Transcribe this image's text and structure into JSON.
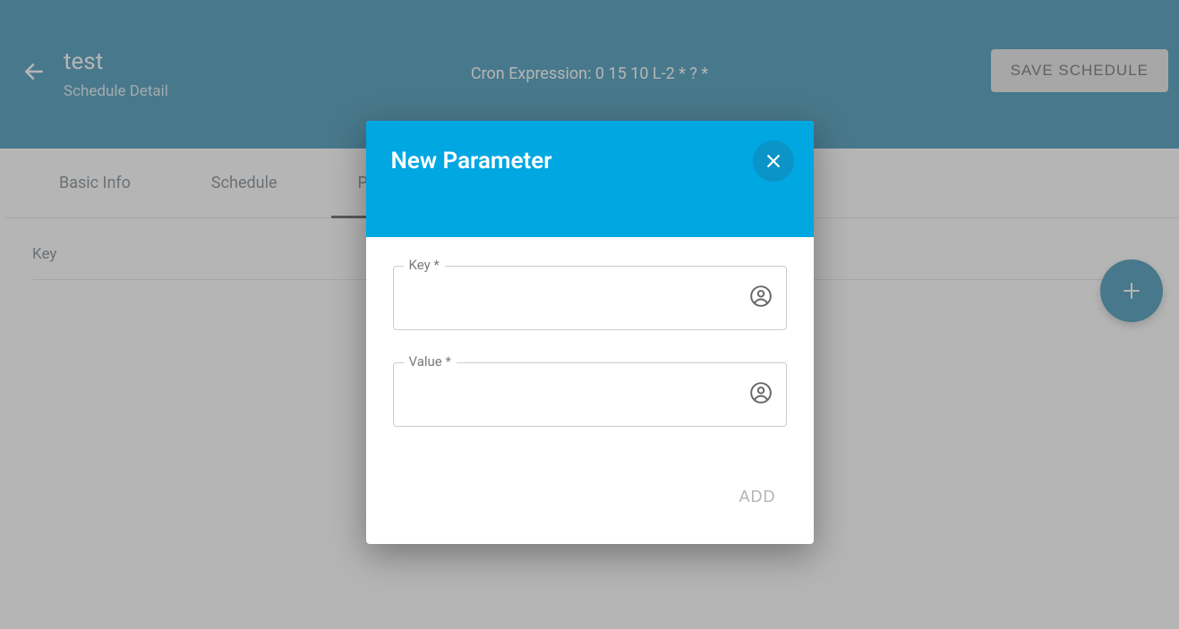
{
  "header": {
    "title": "test",
    "subtitle": "Schedule Detail",
    "cron_label": "Cron Expression: 0 15 10 L-2 * ? *",
    "save_label": "SAVE SCHEDULE"
  },
  "tabs": {
    "items": [
      {
        "label": "Basic Info"
      },
      {
        "label": "Schedule"
      },
      {
        "label": "Parameters"
      }
    ]
  },
  "table": {
    "columns": {
      "key_label": "Key"
    }
  },
  "dialog": {
    "title": "New Parameter",
    "key_label": "Key *",
    "key_value": "",
    "value_label": "Value *",
    "value_value": "",
    "add_label": "ADD"
  }
}
